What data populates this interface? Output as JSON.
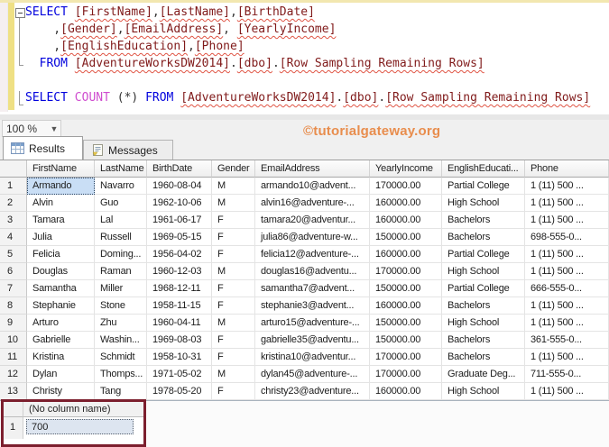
{
  "editor": {
    "lines": [
      {
        "fold": true,
        "tokens": [
          {
            "c": "kw",
            "t": "SELECT"
          },
          {
            "c": "pl",
            "t": " "
          },
          {
            "c": "id",
            "t": "[FirstName]"
          },
          {
            "c": "pl",
            "t": ","
          },
          {
            "c": "id",
            "t": "[LastName]"
          },
          {
            "c": "pl",
            "t": ","
          },
          {
            "c": "id",
            "t": "[BirthDate]"
          }
        ]
      },
      {
        "tokens": [
          {
            "c": "pl",
            "t": "    ,"
          },
          {
            "c": "id",
            "t": "[Gender]"
          },
          {
            "c": "pl",
            "t": ","
          },
          {
            "c": "id",
            "t": "[EmailAddress]"
          },
          {
            "c": "pl",
            "t": ", "
          },
          {
            "c": "id",
            "t": "[YearlyIncome]"
          }
        ]
      },
      {
        "tokens": [
          {
            "c": "pl",
            "t": "    ,"
          },
          {
            "c": "id",
            "t": "[EnglishEducation]"
          },
          {
            "c": "pl",
            "t": ","
          },
          {
            "c": "id",
            "t": "[Phone]"
          }
        ]
      },
      {
        "tokens": [
          {
            "c": "pl",
            "t": "  "
          },
          {
            "c": "kw",
            "t": "FROM"
          },
          {
            "c": "pl",
            "t": " "
          },
          {
            "c": "id",
            "t": "[AdventureWorksDW2014]"
          },
          {
            "c": "pl",
            "t": "."
          },
          {
            "c": "id",
            "t": "[dbo]"
          },
          {
            "c": "pl",
            "t": "."
          },
          {
            "c": "id",
            "t": "[Row Sampling Remaining Rows]"
          }
        ]
      },
      {
        "tokens": []
      },
      {
        "tokens": [
          {
            "c": "kw",
            "t": "SELECT"
          },
          {
            "c": "pl",
            "t": " "
          },
          {
            "c": "fn",
            "t": "COUNT"
          },
          {
            "c": "pl",
            "t": " (*) "
          },
          {
            "c": "kw",
            "t": "FROM"
          },
          {
            "c": "pl",
            "t": " "
          },
          {
            "c": "id",
            "t": "[AdventureWorksDW2014]"
          },
          {
            "c": "pl",
            "t": "."
          },
          {
            "c": "id",
            "t": "[dbo]"
          },
          {
            "c": "pl",
            "t": "."
          },
          {
            "c": "id",
            "t": "[Row Sampling Remaining Rows]"
          }
        ]
      }
    ]
  },
  "toolbar": {
    "zoom_level": "100 %"
  },
  "watermark": "©tutorialgateway.org",
  "tabs": {
    "results": "Results",
    "messages": "Messages"
  },
  "grid": {
    "columns": [
      "FirstName",
      "LastName",
      "BirthDate",
      "Gender",
      "EmailAddress",
      "YearlyIncome",
      "EnglishEducati...",
      "Phone"
    ],
    "rows": [
      [
        "1",
        "Armando",
        "Navarro",
        "1960-08-04",
        "M",
        "armando10@advent...",
        "170000.00",
        "Partial College",
        "1 (11) 500 ..."
      ],
      [
        "2",
        "Alvin",
        "Guo",
        "1962-10-06",
        "M",
        "alvin16@adventure-...",
        "160000.00",
        "High School",
        "1 (11) 500 ..."
      ],
      [
        "3",
        "Tamara",
        "Lal",
        "1961-06-17",
        "F",
        "tamara20@adventur...",
        "160000.00",
        "Bachelors",
        "1 (11) 500 ..."
      ],
      [
        "4",
        "Julia",
        "Russell",
        "1969-05-15",
        "F",
        "julia86@adventure-w...",
        "150000.00",
        "Bachelors",
        "698-555-0..."
      ],
      [
        "5",
        "Felicia",
        "Doming...",
        "1956-04-02",
        "F",
        "felicia12@adventure-...",
        "160000.00",
        "Partial College",
        "1 (11) 500 ..."
      ],
      [
        "6",
        "Douglas",
        "Raman",
        "1960-12-03",
        "M",
        "douglas16@adventu...",
        "170000.00",
        "High School",
        "1 (11) 500 ..."
      ],
      [
        "7",
        "Samantha",
        "Miller",
        "1968-12-11",
        "F",
        "samantha7@advent...",
        "150000.00",
        "Partial College",
        "666-555-0..."
      ],
      [
        "8",
        "Stephanie",
        "Stone",
        "1958-11-15",
        "F",
        "stephanie3@advent...",
        "160000.00",
        "Bachelors",
        "1 (11) 500 ..."
      ],
      [
        "9",
        "Arturo",
        "Zhu",
        "1960-04-11",
        "M",
        "arturo15@adventure-...",
        "150000.00",
        "High School",
        "1 (11) 500 ..."
      ],
      [
        "10",
        "Gabrielle",
        "Washin...",
        "1969-08-03",
        "F",
        "gabrielle35@adventu...",
        "150000.00",
        "Bachelors",
        "361-555-0..."
      ],
      [
        "11",
        "Kristina",
        "Schmidt",
        "1958-10-31",
        "F",
        "kristina10@adventur...",
        "170000.00",
        "Bachelors",
        "1 (11) 500 ..."
      ],
      [
        "12",
        "Dylan",
        "Thomps...",
        "1971-05-02",
        "M",
        "dylan45@adventure-...",
        "170000.00",
        "Graduate Deg...",
        "711-555-0..."
      ],
      [
        "13",
        "Christy",
        "Tang",
        "1978-05-20",
        "F",
        "christy23@adventure...",
        "160000.00",
        "High School",
        "1 (11) 500 ..."
      ]
    ],
    "selected_cell": {
      "row": 0,
      "col": 0
    }
  },
  "count_result": {
    "header": "(No column name)",
    "row_number": "1",
    "value": "700"
  },
  "colors": {
    "keyword_blue": "#0000dd",
    "function_magenta": "#cf4ccf",
    "identifier_maroon": "#801a1a",
    "squiggle_red": "#e05545",
    "change_strip_yellow": "#efe084",
    "watermark_orange": "#e8833c",
    "highlight_box_maroon": "#7c1f2e",
    "selected_cell_blue": "#c9def5"
  }
}
